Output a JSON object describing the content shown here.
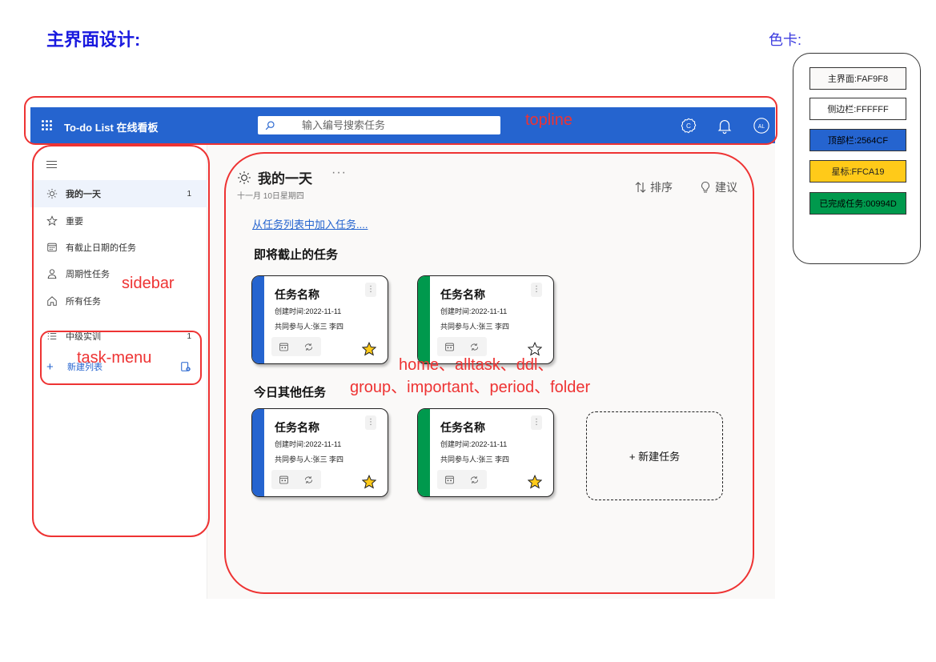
{
  "page_heading": "主界面设计:",
  "color_card": {
    "title": "色卡:",
    "swatches": [
      {
        "label": "主界面:FAF9F8",
        "color": "#FAF9F8"
      },
      {
        "label": "侧边栏:FFFFFF",
        "color": "#FFFFFF"
      },
      {
        "label": "顶部栏:2564CF",
        "color": "#2564CF"
      },
      {
        "label": "星标:FFCA19",
        "color": "#FFCA19"
      },
      {
        "label": "已完成任务:00994D",
        "color": "#00994D"
      }
    ]
  },
  "topbar": {
    "app_title": "To-do List 在线看板",
    "search_placeholder": "输入编号搜索任务",
    "avatar_initials": "AL",
    "icons": [
      "waffle-icon",
      "search-icon",
      "gear-icon",
      "bell-icon",
      "avatar"
    ]
  },
  "sidebar": {
    "items": [
      {
        "label": "我的一天",
        "count": "1",
        "icon": "sun-icon"
      },
      {
        "label": "重要",
        "count": "",
        "icon": "star-icon"
      },
      {
        "label": "有截止日期的任务",
        "count": "",
        "icon": "calendar-icon"
      },
      {
        "label": "周期性任务",
        "count": "",
        "icon": "person-icon"
      },
      {
        "label": "所有任务",
        "count": "",
        "icon": "home-icon"
      }
    ],
    "lists": [
      {
        "label": "中级实训",
        "count": "1",
        "icon": "list-icon"
      }
    ],
    "new_list_label": "新建列表",
    "bottom_icons": [
      "mail-icon",
      "calendar-icon",
      "people-icon",
      "attachment-icon",
      "check-icon"
    ]
  },
  "main": {
    "title": "我的一天",
    "more": "···",
    "date": "十一月 10日星期四",
    "sort_label": "排序",
    "suggest_label": "建议",
    "add_from_list": "从任务列表中加入任务....",
    "sections": [
      {
        "title": "即将截止的任务",
        "tasks": [
          {
            "name": "任务名称",
            "created": "创建时间:2022-11-11",
            "members": "共同参与人:张三 李四",
            "bar_color": "#2564CF",
            "starred": true
          },
          {
            "name": "任务名称",
            "created": "创建时间:2022-11-11",
            "members": "共同参与人:张三 李四",
            "bar_color": "#00994D",
            "starred": false
          }
        ]
      },
      {
        "title": "今日其他任务",
        "tasks": [
          {
            "name": "任务名称",
            "created": "创建时间:2022-11-11",
            "members": "共同参与人:张三 李四",
            "bar_color": "#2564CF",
            "starred": true
          },
          {
            "name": "任务名称",
            "created": "创建时间:2022-11-11",
            "members": "共同参与人:张三 李四",
            "bar_color": "#00994D",
            "starred": true
          }
        ]
      }
    ],
    "new_task_label": "+ 新建任务"
  },
  "annotations": {
    "topline": "topline",
    "sidebar": "sidebar",
    "task_menu": "task-menu",
    "views_line1": "home、alltask、ddl、",
    "views_line2": "group、important、period、folder"
  },
  "colors": {
    "main_bg": "#FAF9F8",
    "sidebar_bg": "#FFFFFF",
    "topbar_bg": "#2564CF",
    "star": "#FFCA19",
    "done": "#00994D",
    "annotation": "#EE3333"
  }
}
